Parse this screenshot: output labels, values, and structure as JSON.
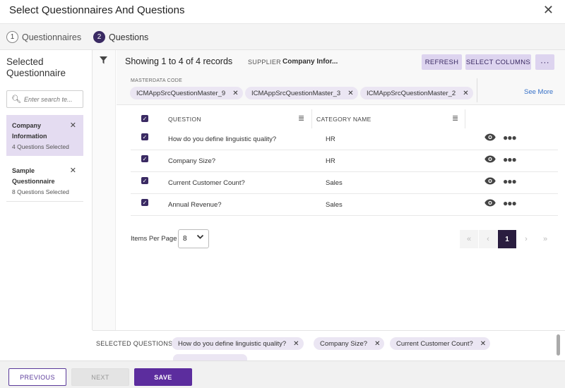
{
  "header": {
    "title": "Select Questionnaires And Questions",
    "close_icon": "close-icon"
  },
  "steps": [
    {
      "num": "1",
      "label": "Questionnaires"
    },
    {
      "num": "2",
      "label": "Questions"
    }
  ],
  "sidebar": {
    "title": "Selected Questionnaire",
    "search_placeholder": "Enter search te...",
    "questionnaires": [
      {
        "name": "Company Information",
        "count": "4 Questions Selected"
      },
      {
        "name": "Sample Questionnaire",
        "count": "8 Questions Selected"
      }
    ]
  },
  "toolbar": {
    "records": "Showing 1 to 4 of 4 records",
    "supplier_label": "SUPPLIER",
    "supplier_value": "Company Infor...",
    "refresh_label": "REFRESH",
    "select_columns_label": "SELECT COLUMNS",
    "more_label": "···"
  },
  "masterdata": {
    "label": "MASTERDATA CODE",
    "chips": [
      "ICMAppSrcQuestionMaster_9",
      "ICMAppSrcQuestionMaster_3",
      "ICMAppSrcQuestionMaster_2"
    ],
    "see_more": "See More"
  },
  "table": {
    "headers": {
      "question": "QUESTION",
      "category": "CATEGORY NAME"
    },
    "rows": [
      {
        "question": "How do you define linguistic quality?",
        "category": "HR"
      },
      {
        "question": "Company Size?",
        "category": "HR"
      },
      {
        "question": "Current Customer Count?",
        "category": "Sales"
      },
      {
        "question": "Annual Revenue?",
        "category": "Sales"
      }
    ]
  },
  "pagination": {
    "items_per_page_label": "Items Per Page",
    "items_per_page": "8",
    "current_page": "1"
  },
  "selected_questions": {
    "label": "SELECTED QUESTIONS",
    "chips": [
      "How do you define linguistic quality?",
      "Company Size?",
      "Current Customer Count?"
    ]
  },
  "footer": {
    "previous": "PREVIOUS",
    "next": "NEXT",
    "save": "SAVE"
  },
  "colors": {
    "accent": "#5c2d9e",
    "chip": "#ebe6f3",
    "selected_card": "#e4dcf1",
    "dark_page": "#2a1d3f"
  }
}
